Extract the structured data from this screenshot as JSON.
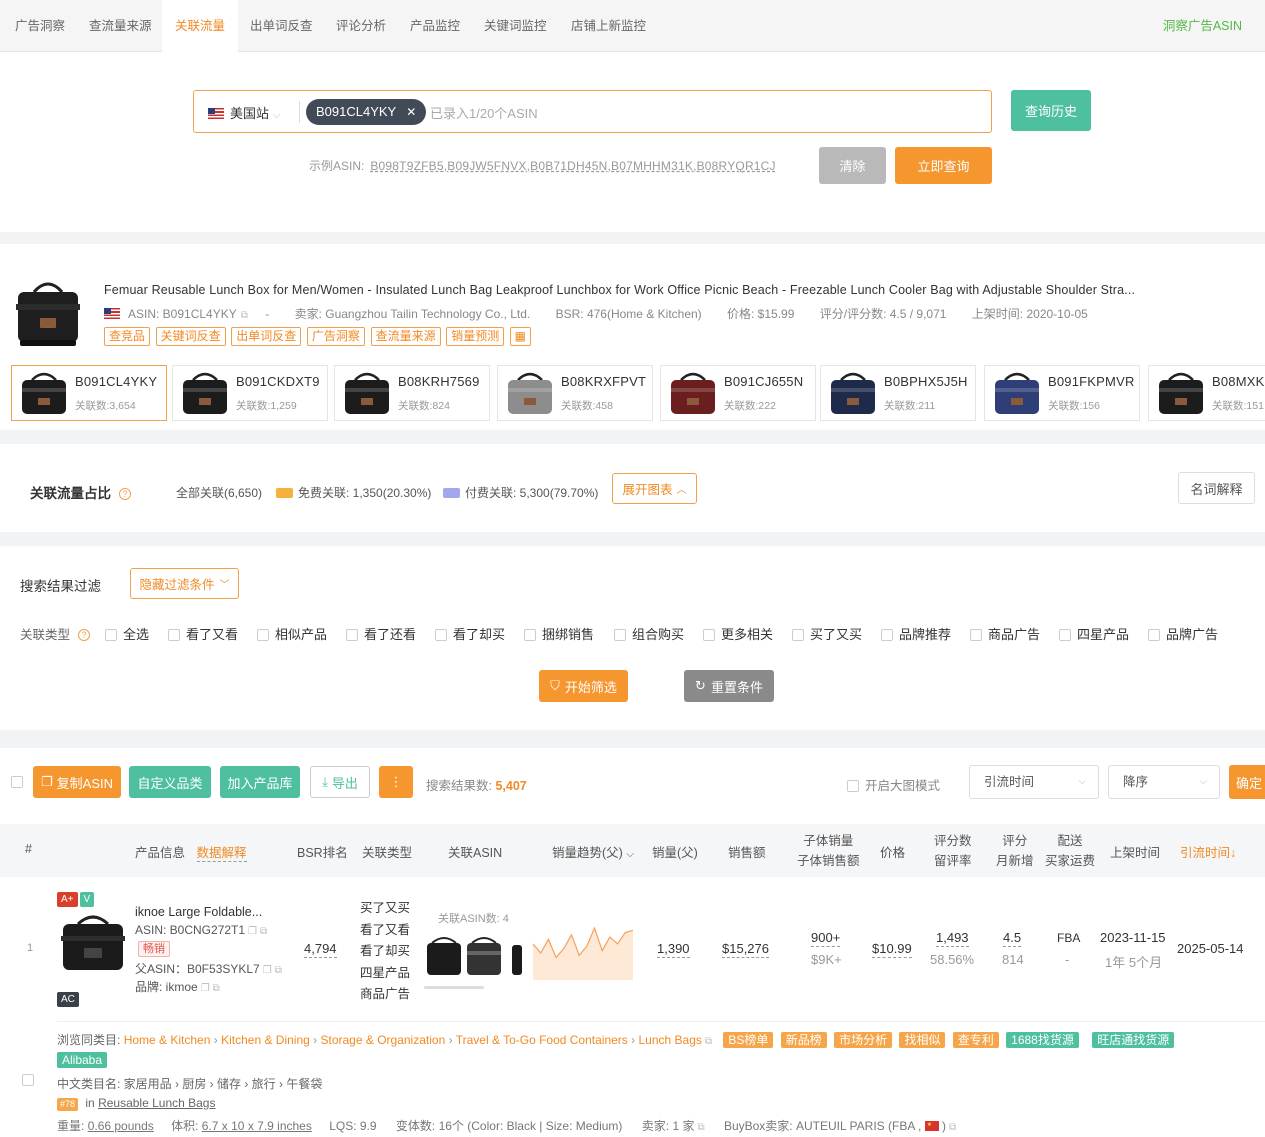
{
  "nav": {
    "tabs": [
      "广告洞察",
      "查流量来源",
      "关联流量",
      "出单词反查",
      "评论分析",
      "产品监控",
      "关键词监控",
      "店铺上新监控"
    ],
    "active_index": 2,
    "right_link": "洞察广告ASIN"
  },
  "search": {
    "site": "美国站",
    "chip": "B091CL4YKY",
    "placeholder": "已录入1/20个ASIN",
    "history_button": "查询历史",
    "example_label": "示例ASIN:",
    "example_asins": "B098T9ZFB5,B09JW5FNVX,B0B71DH45N,B07MHHM31K,B08RYQR1CJ",
    "clear_button": "清除",
    "query_button": "立即查询"
  },
  "product": {
    "title": "Femuar Reusable Lunch Box for Men/Women - Insulated Lunch Bag Leakproof Lunchbox for Work Office Picnic Beach - Freezable Lunch Cooler Bag with Adjustable Shoulder Stra...",
    "asin": "ASIN: B091CL4YKY",
    "dash": "-",
    "seller": "卖家: Guangzhou Tailin Technology Co., Ltd.",
    "bsr": "BSR: 476(Home & Kitchen)",
    "price": "价格: $15.99",
    "rating": "评分/评分数: 4.5 / 9,071",
    "listed": "上架时间: 2020-10-05",
    "tags": [
      "查竞品",
      "关键词反查",
      "出单词反查",
      "广告洞察",
      "查流量来源",
      "销量预测"
    ]
  },
  "variants": [
    {
      "asin": "B091CL4YKY",
      "count": "关联数:3,654",
      "color": "#1c1c1c"
    },
    {
      "asin": "B091CKDXT9",
      "count": "关联数:1,259",
      "color": "#1c1c1c"
    },
    {
      "asin": "B08KRH7569",
      "count": "关联数:824",
      "color": "#1c1c1c"
    },
    {
      "asin": "B08KRXFPVT",
      "count": "关联数:458",
      "color": "#8d8d8d"
    },
    {
      "asin": "B091CJ655N",
      "count": "关联数:222",
      "color": "#6b1e1e"
    },
    {
      "asin": "B0BPHX5J5H",
      "count": "关联数:211",
      "color": "#1e2a4a"
    },
    {
      "asin": "B091FKPMVR",
      "count": "关联数:156",
      "color": "#2e3f78"
    },
    {
      "asin": "B08MXK",
      "count": "关联数:151",
      "color": "#1c1c1c"
    }
  ],
  "ratio": {
    "title": "关联流量占比",
    "all": "全部关联(6,650)",
    "free": "免费关联: 1,350(20.30%)",
    "paid": "付费关联: 5,300(79.70%)",
    "expand": "展开图表",
    "glossary": "名词解释",
    "colors": {
      "free": "#f5b13d",
      "paid": "#a3a7ee"
    }
  },
  "filter": {
    "title": "搜索结果过滤",
    "toggle": "隐藏过滤条件",
    "type_label": "关联类型",
    "types": [
      "全选",
      "看了又看",
      "相似产品",
      "看了还看",
      "看了却买",
      "捆绑销售",
      "组合购买",
      "更多相关",
      "买了又买",
      "品牌推荐",
      "商品广告",
      "四星产品",
      "品牌广告"
    ],
    "start": "开始筛选",
    "reset": "重置条件"
  },
  "toolbar": {
    "copy": "复制ASIN",
    "custom": "自定义品类",
    "add": "加入产品库",
    "export": "导出",
    "more": "⋮",
    "result_label": "搜索结果数:",
    "result_count": "5,407",
    "bigimg": "开启大图模式",
    "sort_field": "引流时间",
    "sort_order": "降序",
    "confirm": "确定"
  },
  "table": {
    "headers": {
      "index": "#",
      "info": "产品信息",
      "info_link": "数据解释",
      "bsr": "BSR排名",
      "type": "关联类型",
      "asin": "关联ASIN",
      "trend": "销量趋势(父)",
      "sales": "销量(父)",
      "revenue": "销售额",
      "child1": "子体销量",
      "child2": "子体销售额",
      "price": "价格",
      "reviews1": "评分数",
      "reviews2": "留评率",
      "score1": "评分",
      "score2": "月新增",
      "ship1": "配送",
      "ship2": "买家运费",
      "listed": "上架时间",
      "traffic": "引流时间↓"
    },
    "row": {
      "index": "1",
      "badge_aplus": "A+",
      "badge_v": "V",
      "badge_ac": "AC",
      "name": "iknoe Large Foldable...",
      "asin": "ASIN: B0CNG272T1",
      "hot": "畅销",
      "parent": "父ASIN：B0F53SYKL7",
      "brand": "品牌: ikmoe",
      "bsr": "4,794",
      "types": [
        "买了又买",
        "看了又看",
        "看了却买",
        "四星产品",
        "商品广告"
      ],
      "related_count": "关联ASIN数: 4",
      "sales": "1,390",
      "revenue": "$15,276",
      "child_sales": "900+",
      "child_revenue": "$9K+",
      "price": "$10.99",
      "reviews": "1,493",
      "review_rate": "58.56%",
      "score": "4.5",
      "monthly_new": "814",
      "ship": "FBA",
      "ship_fee": "-",
      "listed": "2023-11-15",
      "age": "1年 5个月",
      "traffic": "2025-05-14"
    },
    "trend": [
      30,
      22,
      34,
      18,
      26,
      38,
      20,
      28,
      44,
      24,
      36,
      30,
      40,
      42
    ]
  },
  "detail": {
    "browse_label": "浏览同类目:",
    "crumbs": [
      "Home & Kitchen",
      "Kitchen & Dining",
      "Storage & Organization",
      "Travel & To-Go Food Containers",
      "Lunch Bags"
    ],
    "buttons": [
      "BS榜单",
      "新品榜",
      "市场分析",
      "找相似",
      "查专利",
      "1688找货源",
      "旺店通找货源",
      "Alibaba"
    ],
    "cn_cat": "中文类目名: 家居用品 › 厨房 › 储存 › 旅行 › 午餐袋",
    "rank_badge": "#78",
    "rank_in": "in",
    "rank_cat": "Reusable Lunch Bags",
    "weight": "重量:",
    "weight_val": "0.66 pounds",
    "size": "体积:",
    "size_val": "6.7 x 10 x 7.9 inches",
    "lqs": "LQS: 9.9",
    "variants": "变体数: 16个 (Color: Black | Size: Medium)",
    "sellers": "卖家: 1 家",
    "buybox": "BuyBox卖家: AUTEUIL PARIS (FBA ,",
    "buybox_end": ")"
  },
  "colors": {
    "accent": "#f08a24",
    "green": "#52b849",
    "teal": "#4ec0a0",
    "gray": "#b9b9b9"
  }
}
